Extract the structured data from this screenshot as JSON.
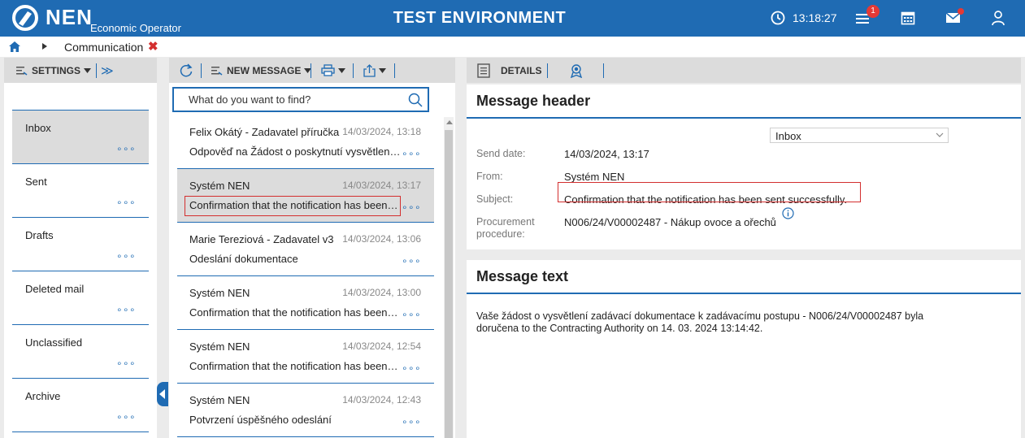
{
  "header": {
    "brand": "NEN",
    "brand_sub": "Economic Operator",
    "env_title": "TEST ENVIRONMENT",
    "time": "13:18:27",
    "notification_count": "1",
    "accent_color": "#1f6bb3"
  },
  "breadcrumb": {
    "label": "Communication",
    "close": "✖"
  },
  "left": {
    "settings_label": "SETTINGS",
    "expand_label": "≫",
    "folders": [
      {
        "name": "Inbox",
        "dots": "∘∘∘"
      },
      {
        "name": "Sent",
        "dots": "∘∘∘"
      },
      {
        "name": "Drafts",
        "dots": "∘∘∘"
      },
      {
        "name": "Deleted mail",
        "dots": "∘∘∘"
      },
      {
        "name": "Unclassified",
        "dots": "∘∘∘"
      },
      {
        "name": "Archive",
        "dots": "∘∘∘"
      }
    ]
  },
  "middle": {
    "new_message_label": "NEW MESSAGE",
    "search_placeholder": "What do you want to find?",
    "messages": [
      {
        "sender": "Felix Okátý - Zadavatel příručka",
        "date": "14/03/2024, 13:18",
        "subject": "Odpověď na Žádost o poskytnutí vysvětlení zadávací dokumentace",
        "dots": "∘∘∘"
      },
      {
        "sender": "Systém NEN",
        "date": "14/03/2024, 13:17",
        "subject": "Confirmation that the notification has been sent successfully.",
        "dots": "∘∘∘"
      },
      {
        "sender": "Marie Tereziová - Zadavatel v3",
        "date": "14/03/2024, 13:06",
        "subject": "Odeslání dokumentace",
        "dots": "∘∘∘"
      },
      {
        "sender": "Systém NEN",
        "date": "14/03/2024, 13:00",
        "subject": "Confirmation that the notification has been sent successfully.",
        "dots": "∘∘∘"
      },
      {
        "sender": "Systém NEN",
        "date": "14/03/2024, 12:54",
        "subject": "Confirmation that the notification has been sent successfully.",
        "dots": "∘∘∘"
      },
      {
        "sender": "Systém NEN",
        "date": "14/03/2024, 12:43",
        "subject": "Potvrzení úspěšného odeslání",
        "dots": "∘∘∘"
      }
    ]
  },
  "right": {
    "details_label": "DETAILS",
    "header_title": "Message header",
    "folder_select": "Inbox",
    "send_date_label": "Send date:",
    "send_date": "14/03/2024, 13:17",
    "from_label": "From:",
    "from": "Systém NEN",
    "subject_label": "Subject:",
    "subject": "Confirmation that the notification has been sent successfully.",
    "procedure_label_1": "Procurement",
    "procedure_label_2": "procedure:",
    "procedure": "N006/24/V00002487 - Nákup ovoce a ořechů",
    "text_title": "Message text",
    "text_line_1": "Vaše žádost o vysvětlení zadávací dokumentace k zadávacímu postupu  - N006/24/V00002487 byla",
    "text_line_2": "doručena to the Contracting Authority on 14. 03. 2024 13:14:42."
  }
}
